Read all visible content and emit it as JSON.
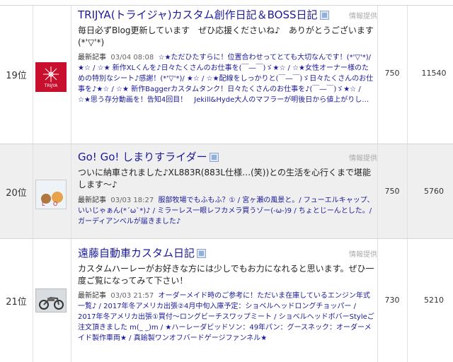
{
  "rows": [
    {
      "rank": "19位",
      "title": "TRIJYA(トライジャ)カスタム創作日記＆BOSS日記",
      "info": "情報提供",
      "desc": "毎日必ずBlog更新しています　ぜひ応援くださいね♪　ありがとうございます(*'▽'*)",
      "latest_label": "最新記事",
      "latest_date": "03/04 08:08",
      "latest_text": "☆★ただひたすらに！位置合わせってとても大切なんです！(*'▽'*)/ ★☆ / ☆★ 新作XLくんを♪日々たくさんのお仕事を(￣―￣)ゞ★☆ / ☆★女性オーナー様のための特別なシート♪感謝！(*'▽'*)/ ★☆ / ☆★配線をしっかりと(￣―￣)ゞ日々たくさんのお仕事を♪★☆ / ☆★ 新作Baggerカスタムタンク！日々たくさんのお仕事を♪(￣―￣)ゞ★☆ / ☆★思う存分動画を！告知4回目！　Jekill&Hyde大人のマフラーが明後日から値上がりし…",
      "views": "750",
      "points": "11540",
      "thumb_text": "TRIJYA"
    },
    {
      "rank": "20位",
      "title": "Go! Go! しまりすライダー",
      "info": "情報提供",
      "desc": "ついに納車されました♪XL883R(883L仕様…(笑))との生活を心行くまで堪能します～♪",
      "latest_label": "最新記事",
      "latest_date": "03/03 18:27",
      "latest_text": "服部牧場でもふもふ？① / 宮ヶ瀬の風景と。/ フューエルキャップ、いいじゃぁん(*´ω`*)♪ / ミラーレス一眼レフカメラ買うゾー(-ω-)9 / ちょとじーんとした。/ ガーディアンベルが届きました♪",
      "views": "750",
      "points": "5760",
      "thumb_text": ""
    },
    {
      "rank": "21位",
      "title": "遠藤自動車カスタム日記",
      "info": "情報提供",
      "desc": "カスタムハーレーがお好きな方には少しでもお力になれると思います。ぜひ一度ご覧になってみて下さい！",
      "latest_label": "最新記事",
      "latest_date": "03/03 21:57",
      "latest_text": "オーダーメイド時のご参考に！ただいま在庫しているエンジン年式一覧♪ / 2017年冬アメリカ出張②4月中旬入庫予定：ショベルヘッドロングチョッパー / 2017年冬アメリカ出張①買付～ロングビーチスワップミート / ショベルヘッドボバーStyleご注文頂きました m(_ _)m / ★ハーレーダビッドソン：49年パン：グースネック：オーダーメイド製作車両★ / 真鍮製ワンオフバードゲージファンネル★",
      "views": "730",
      "points": "5210",
      "thumb_text": ""
    }
  ]
}
